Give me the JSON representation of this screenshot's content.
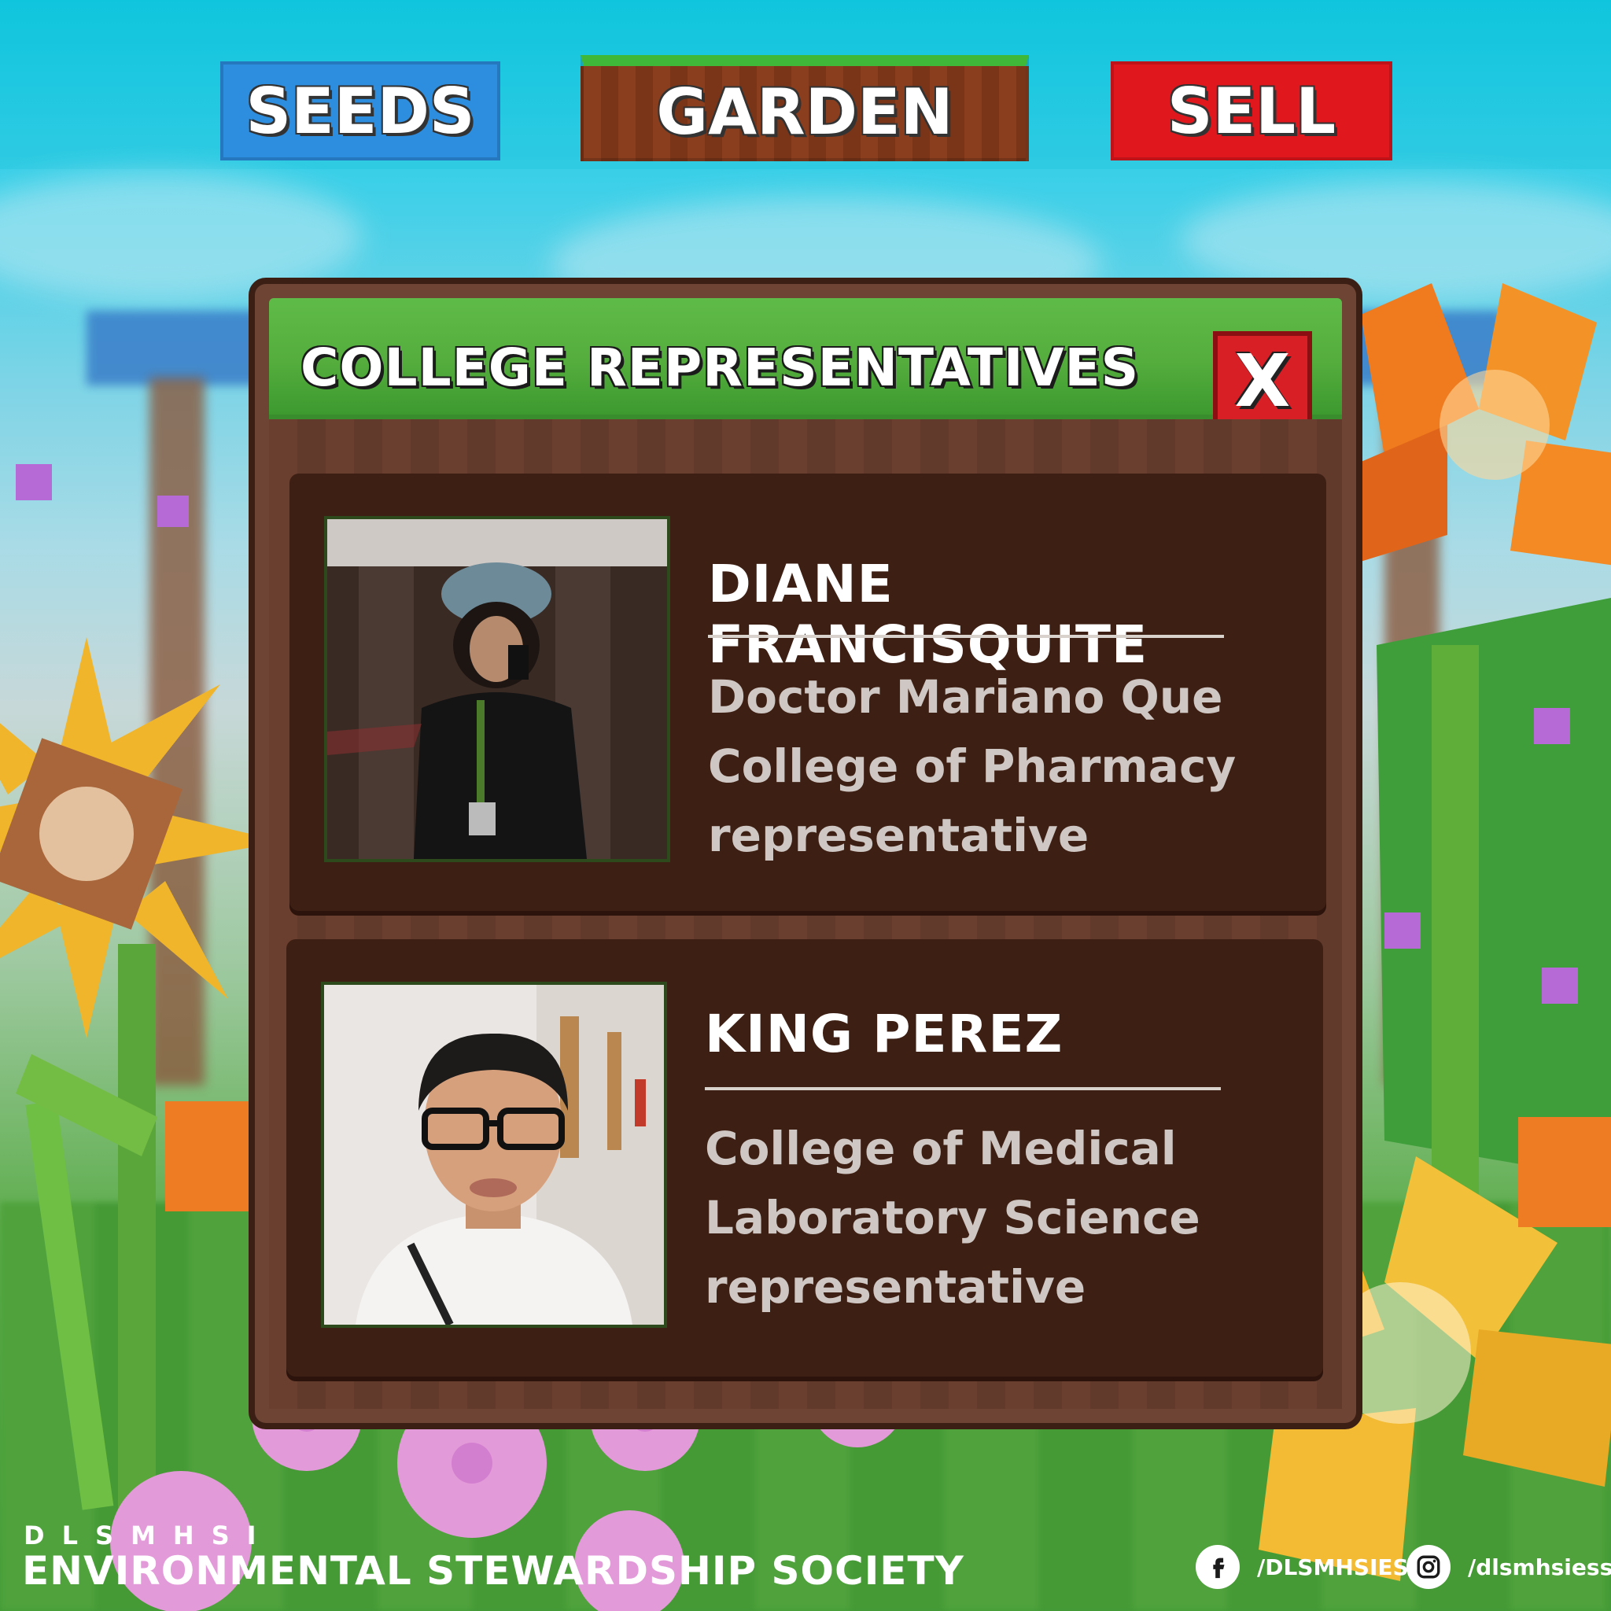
{
  "nav": {
    "seeds_label": "SEEDS",
    "garden_label": "GARDEN",
    "sell_label": "SELL"
  },
  "panel": {
    "title": "COLLEGE REPRESENTATIVES",
    "close_label": "X"
  },
  "representatives": [
    {
      "name": "DIANE FRANCISQUITE",
      "role": "Doctor Mariano Que\nCollege of Pharmacy\nrepresentative"
    },
    {
      "name": "KING PEREZ",
      "role": "College of Medical\nLaboratory Science\nrepresentative"
    }
  ],
  "footer": {
    "org_short": "DLSMHSI",
    "org_name": "ENVIRONMENTAL STEWARDSHIP SOCIETY",
    "facebook_handle": "/DLSMHSIESS",
    "instagram_handle": "/dlsmhsiess"
  },
  "colors": {
    "seeds": "#2d8ee0",
    "garden": "#8a3e1e",
    "sell": "#e0181e",
    "panel_header": "#5fbb47",
    "card": "#3e1f14",
    "close": "#d81f26"
  }
}
